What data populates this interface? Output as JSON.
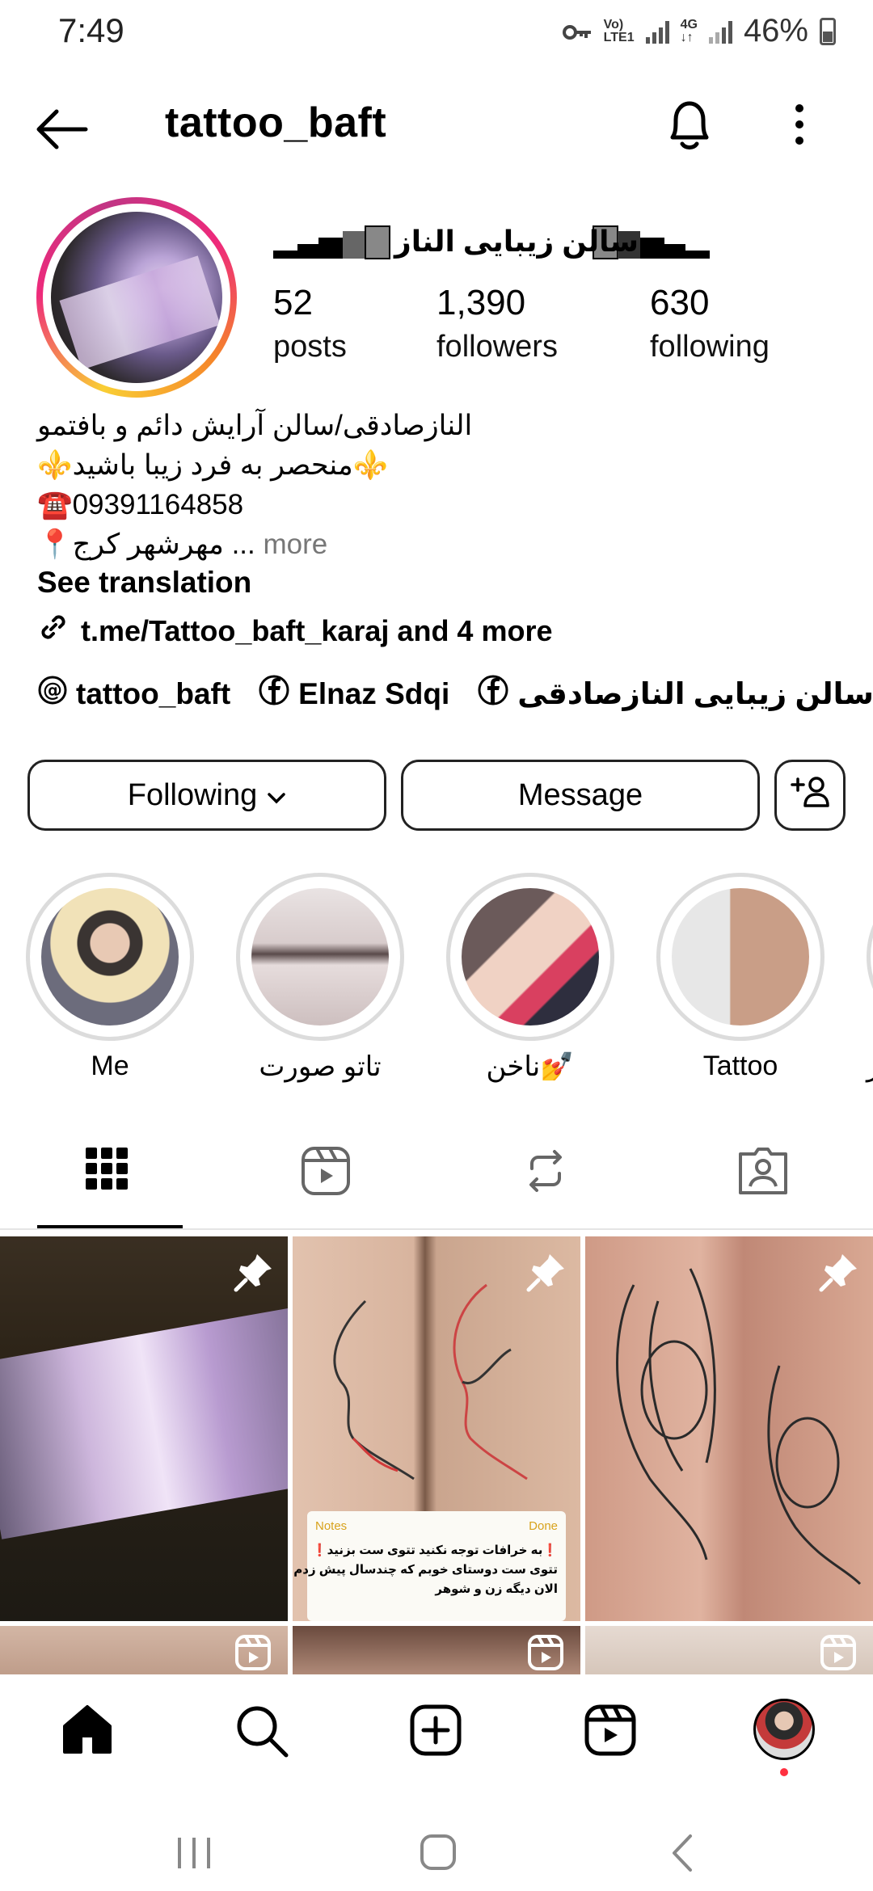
{
  "status_bar": {
    "time": "7:49",
    "network_top": "Vo)",
    "network_bottom": "LTE1",
    "network2_top": "4G",
    "network2_bottom": "↓↑",
    "battery": "46%",
    "icons": [
      "key-icon",
      "signal-icon",
      "battery-icon"
    ]
  },
  "header": {
    "username": "tattoo_baft",
    "icons": [
      "back-arrow-icon",
      "bell-icon",
      "more-vertical-icon"
    ]
  },
  "profile": {
    "display_name": "سالن زیبایی الناز",
    "stats": [
      {
        "value": "52",
        "label": "posts"
      },
      {
        "value": "1,390",
        "label": "followers"
      },
      {
        "value": "630",
        "label": "following"
      }
    ],
    "bio_lines": [
      "النازصادقی/سالن آرایش دائم و بافتمو",
      "⚜️منحصر به فرد زیبا باشید⚜️",
      "☎️09391164858",
      "📍مهرشهر کرج ..."
    ],
    "bio_more": "more",
    "see_translation": "See translation",
    "link_text": "t.me/Tattoo_baft_karaj and 4 more",
    "social": [
      {
        "icon": "threads-icon",
        "label": "tattoo_baft"
      },
      {
        "icon": "facebook-icon",
        "label": "Elnaz Sdqi"
      },
      {
        "icon": "facebook-icon",
        "label": "سالن زیبایی النازصادقی"
      }
    ]
  },
  "actions": {
    "following_label": "Following",
    "message_label": "Message"
  },
  "highlights": [
    {
      "label": "Me"
    },
    {
      "label": "تاتو صورت"
    },
    {
      "label": "ناخن💅"
    },
    {
      "label": "Tattoo"
    },
    {
      "label": "ر"
    }
  ],
  "tabs": [
    "grid-icon",
    "reels-icon",
    "reposts-icon",
    "tagged-icon"
  ],
  "notes_overlay": {
    "back": "Notes",
    "done": "Done",
    "line1": "❗به خرافات توجه نکنید تتوی ست بزنید❗",
    "line2": "تتوی ست دوستای خوبم که چندسال پیش زدم",
    "line3": "الان دیگه زن و شوهر"
  },
  "bottom_nav": [
    "home-icon",
    "search-icon",
    "create-icon",
    "reels-icon",
    "profile-avatar"
  ],
  "colors": {
    "story_ring_start": "#f9ce34",
    "story_ring_mid": "#ee2a7b",
    "notification_dot": "#ff3040",
    "text_primary": "#000000",
    "text_secondary": "#777777"
  }
}
